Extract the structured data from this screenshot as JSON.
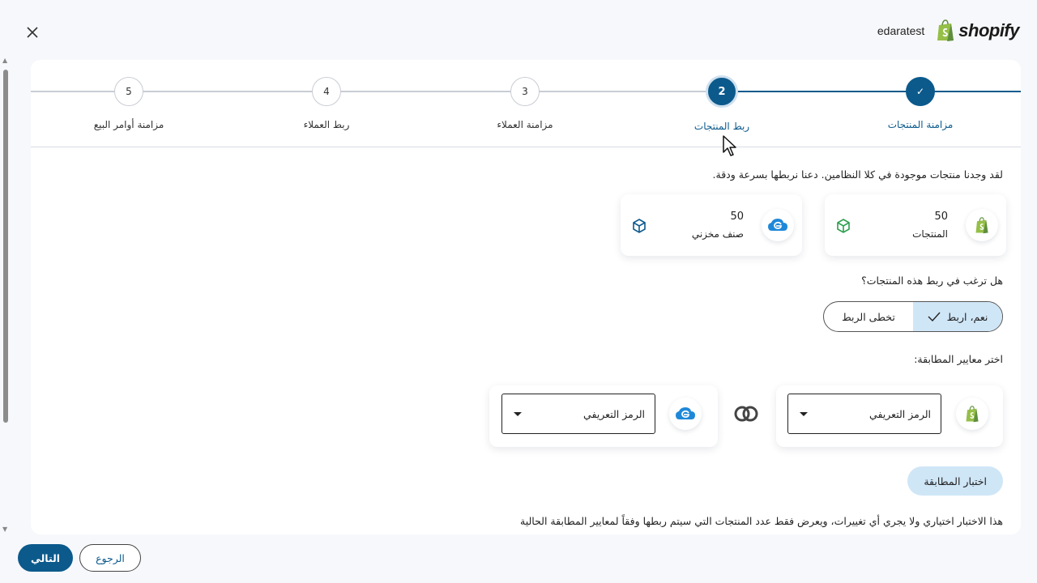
{
  "header": {
    "close_icon": "close-icon",
    "store_name": "edaratest",
    "brand": "shopify",
    "brand_color": "#95bf47"
  },
  "stepper": {
    "steps": [
      {
        "number": "5",
        "label": "مزامنة أوامر البيع",
        "state": "pending"
      },
      {
        "number": "4",
        "label": "ربط العملاء",
        "state": "pending"
      },
      {
        "number": "3",
        "label": "مزامنة العملاء",
        "state": "pending"
      },
      {
        "number": "2",
        "label": "ربط المنتجات",
        "state": "active"
      },
      {
        "number": "✓",
        "label": "مزامنة المنتجات",
        "state": "done"
      }
    ],
    "accent_color": "#0c5a8c"
  },
  "main": {
    "intro": "لقد وجدنا منتجات موجودة في كلا النظامين. دعنا نربطها بسرعة ودقة.",
    "stats": [
      {
        "source": "shopify",
        "count": "50",
        "label": "المنتجات",
        "icon": "green-box-icon"
      },
      {
        "source": "edara-cloud",
        "count": "50",
        "label": "صنف مخزني",
        "icon": "blue-box-icon"
      }
    ],
    "question": "هل ترغب في ربط هذه المنتجات؟",
    "toggle": {
      "yes_label": "نعم، اربط",
      "skip_label": "تخطى الربط",
      "selected": "yes"
    },
    "criteria_label": "اختر معايير المطابقة:",
    "shopify_criteria": "الرمز التعريفي",
    "edara_criteria": "الرمز التعريفي",
    "test_button": "اختبار المطابقة",
    "test_note": "هذا الاختبار اختياري ولا يجري أي تغييرات، ويعرض فقط عدد المنتجات التي سيتم ربطها وفقاً لمعايير المطابقة الحالية"
  },
  "footer": {
    "next_label": "التالي",
    "back_label": "الرجوع"
  }
}
